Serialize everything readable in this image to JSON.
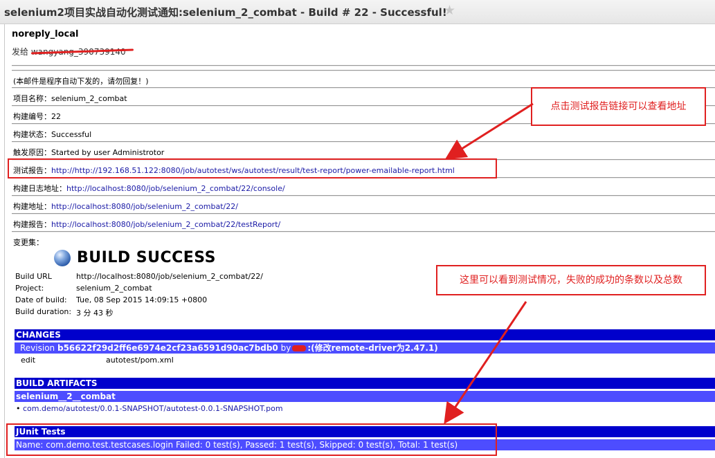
{
  "window": {
    "title": "selenium2项目实战自动化测试通知:selenium_2_combat - Build # 22 - Successful!",
    "star_icon": "star-icon"
  },
  "email": {
    "sender": "noreply_local",
    "recipient_prefix": "发给",
    "recipient_name": "wangyang_390739140"
  },
  "report": {
    "notice": "(本邮件是程序自动下发的，请勿回复！)",
    "fields": [
      {
        "label": "项目名称：",
        "value": "selenium_2_combat",
        "is_link": false
      },
      {
        "label": "构建编号：",
        "value": "22",
        "is_link": false
      },
      {
        "label": "构建状态：",
        "value": "Successful",
        "is_link": false
      },
      {
        "label": "触发原因：",
        "value": "Started by user Administrotor",
        "is_link": false
      },
      {
        "label": "测试报告：",
        "value": "http://http://192.168.51.122:8080/job/autotest/ws/autotest/result/test-report/power-emailable-report.html",
        "is_link": true
      },
      {
        "label": "构建日志地址：",
        "value": "http://localhost:8080/job/selenium_2_combat/22/console/",
        "is_link": true
      },
      {
        "label": "构建地址：",
        "value": "http://localhost:8080/job/selenium_2_combat/22/",
        "is_link": true
      },
      {
        "label": "构建报告：",
        "value": "http://localhost:8080/job/selenium_2_combat/22/testReport/",
        "is_link": true
      }
    ],
    "changeset_label": "变更集："
  },
  "build": {
    "heading": "BUILD SUCCESS",
    "info": [
      {
        "label": "Build URL",
        "value": "http://localhost:8080/job/selenium_2_combat/22/",
        "is_link": true
      },
      {
        "label": "Project:",
        "value": "selenium_2_combat",
        "is_link": false
      },
      {
        "label": "Date of build:",
        "value": "Tue, 08 Sep 2015 14:09:15 +0800",
        "is_link": false
      },
      {
        "label": "Build duration:",
        "value": "3 分 43 秒",
        "is_link": false
      }
    ]
  },
  "changes": {
    "header": "CHANGES",
    "revision_prefix": "Revision",
    "revision_hash": "b56622f29d2ff6e6974e2cf23a6591d90ac7bdb0",
    "revision_by": "by",
    "revision_message": ":(修改remote-driver为2.47.1)",
    "edit_action": "edit",
    "edit_path": "autotest/pom.xml"
  },
  "artifacts": {
    "header": "BUILD ARTIFACTS",
    "project": "selenium__2__combat",
    "item": "com.demo/autotest/0.0.1-SNAPSHOT/autotest-0.0.1-SNAPSHOT.pom"
  },
  "junit": {
    "header": "JUnit Tests",
    "summary": "Name: com.demo.test.testcases.login Failed: 0 test(s), Passed: 1 test(s), Skipped: 0 test(s), Total: 1 test(s)"
  },
  "annotations": {
    "note1": "点击测试报告链接可以查看地址",
    "note2": "这里可以看到测试情况，失败的成功的条数以及总数",
    "color": "#e02020"
  }
}
